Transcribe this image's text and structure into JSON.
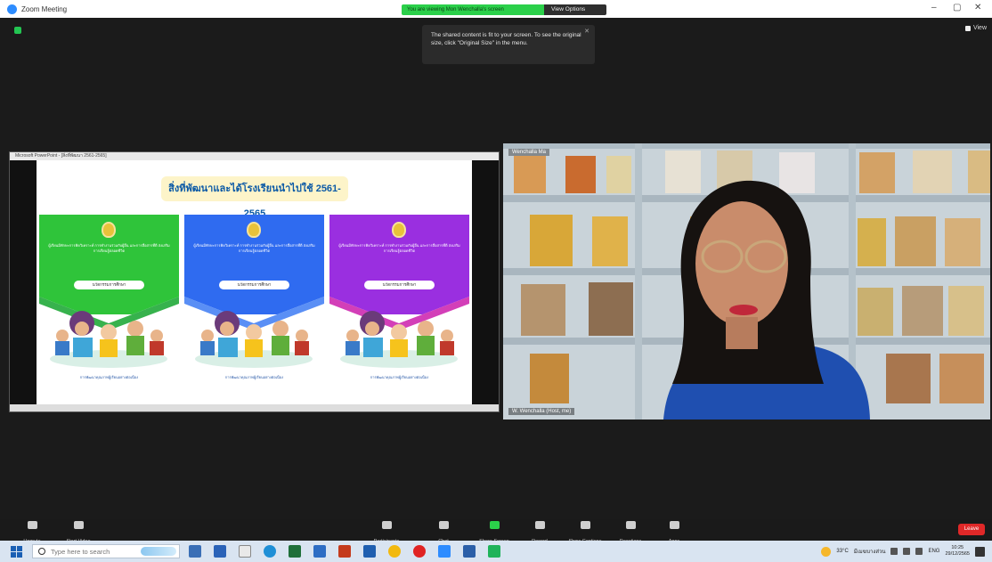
{
  "titlebar": {
    "title": "Zoom Meeting",
    "share_status": "You are viewing Mon Wenchalla's screen",
    "view_options": "View Options",
    "min": "–",
    "max": "▢",
    "close": "✕"
  },
  "stage": {
    "view_label": "View",
    "tooltip": "The shared content is fit to your screen. To see the original size, click \"Original Size\" in the menu."
  },
  "slide": {
    "window_title": "Microsoft PowerPoint - [สิ่งที่พัฒนา 2561-2565]",
    "title": "สิ่งที่พัฒนาและได้โรงเรียนนำไปใช้ 2561- 2565",
    "cards": [
      {
        "color": "#2fc43a",
        "chev": "#37b24d",
        "text": "ผู้เรียนมีทักษะการคิดวิเคราะห์ การทำงานร่วมกับผู้อื่น และการสื่อสารที่ดี ส่งเสริมการเรียนรู้ตลอดชีวิต",
        "button": "นวัตกรรมการศึกษา",
        "foot": "การพัฒนาคุณภาพผู้เรียนอย่างต่อเนื่อง"
      },
      {
        "color": "#2f6bf0",
        "chev": "#5a8ff5",
        "text": "ผู้เรียนมีทักษะการคิดวิเคราะห์ การทำงานร่วมกับผู้อื่น และการสื่อสารที่ดี ส่งเสริมการเรียนรู้ตลอดชีวิต",
        "button": "นวัตกรรมการศึกษา",
        "foot": "การพัฒนาคุณภาพผู้เรียนอย่างต่อเนื่อง"
      },
      {
        "color": "#9a2fe0",
        "chev": "#d33fb8",
        "text": "ผู้เรียนมีทักษะการคิดวิเคราะห์ การทำงานร่วมกับผู้อื่น และการสื่อสารที่ดี ส่งเสริมการเรียนรู้ตลอดชีวิต",
        "button": "นวัตกรรมการศึกษา",
        "foot": "การพัฒนาคุณภาพผู้เรียนอย่างต่อเนื่อง"
      }
    ]
  },
  "video": {
    "participant_label": "Wenchalla Ma",
    "name_tag": "W. Wenchalla (Host, me)"
  },
  "toolbar": {
    "items": [
      {
        "label": "Unmute",
        "icon": "microphone-icon"
      },
      {
        "label": "Start Video",
        "icon": "video-camera-icon"
      },
      {
        "label": "Participants",
        "icon": "participants-icon"
      },
      {
        "label": "Chat",
        "icon": "chat-icon"
      },
      {
        "label": "Share Screen",
        "icon": "share-screen-icon"
      },
      {
        "label": "Record",
        "icon": "record-icon"
      },
      {
        "label": "Show Captions",
        "icon": "captions-icon"
      },
      {
        "label": "Reactions",
        "icon": "reactions-icon"
      },
      {
        "label": "Apps",
        "icon": "apps-icon"
      }
    ],
    "end": "Leave"
  },
  "taskbar": {
    "search_placeholder": "Type here to search",
    "weather": "33°C",
    "weather_text": "มีเมฆบางส่วน",
    "lang": "ENG",
    "time": "10:25",
    "date": "29/12/2565"
  },
  "colors": {
    "green": "#2bd04a",
    "end_red": "#e02828",
    "zoom_blue": "#2d8cff"
  }
}
